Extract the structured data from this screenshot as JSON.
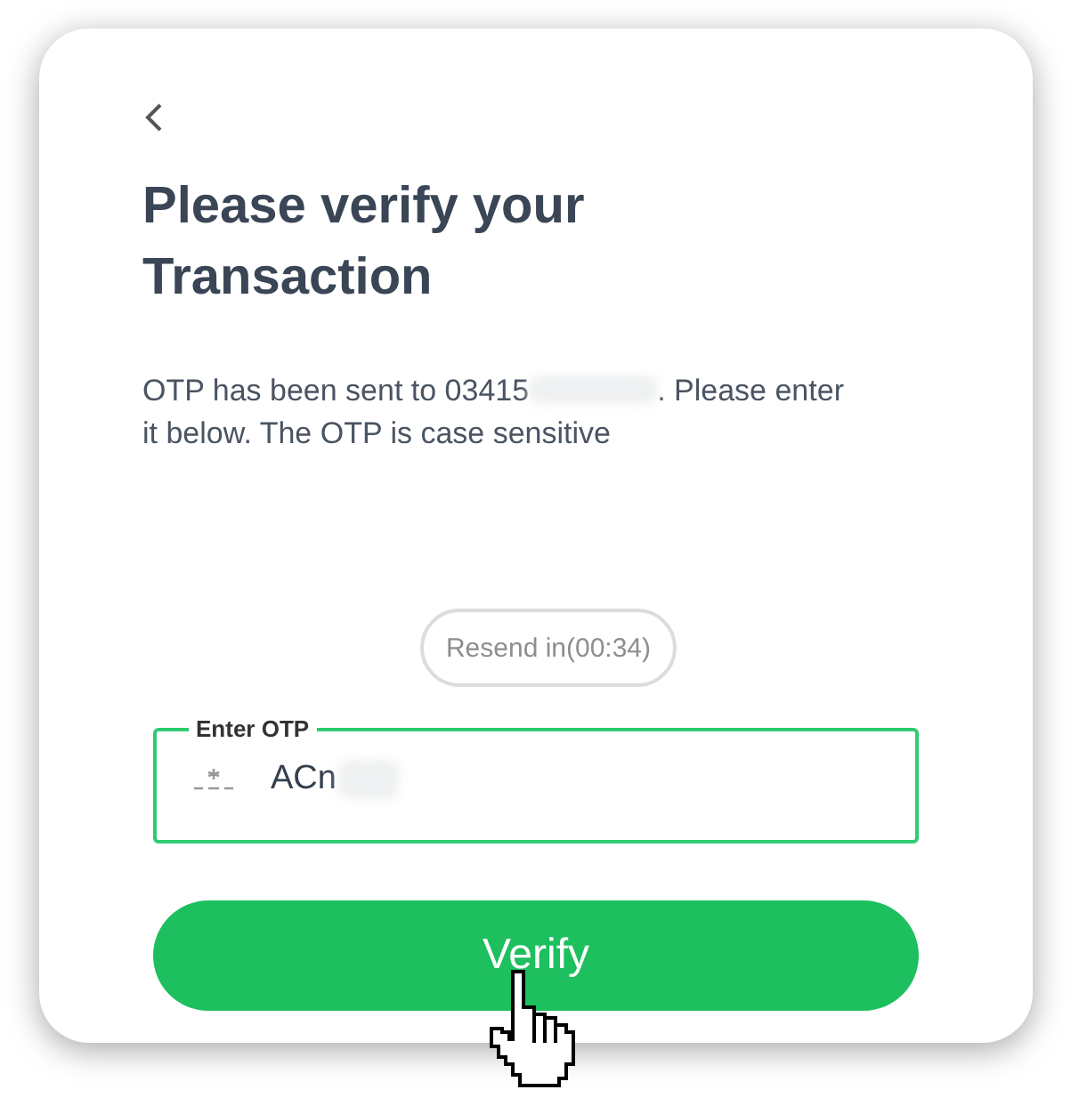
{
  "title": "Please verify your Transaction",
  "message": {
    "before": "OTP has been sent to 03415",
    "after": ". Please enter it below. The OTP is case sensitive"
  },
  "resend": {
    "label": "Resend in(00:34)",
    "disabled": true
  },
  "otp_field": {
    "label": "Enter OTP",
    "value": "ACn",
    "focused": true
  },
  "verify_button": {
    "label": "Verify"
  }
}
